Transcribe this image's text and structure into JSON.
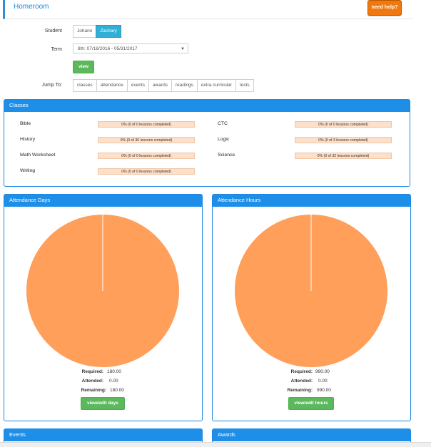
{
  "header": {
    "title": "Homeroom",
    "help_label": "need help?"
  },
  "form": {
    "student_label": "Student",
    "students": [
      "Johann",
      "Zachary"
    ],
    "selected_student": "Zachary",
    "term_label": "Term",
    "term_value": "8th: 07/18/2016 - 05/31/2017",
    "view_label": "view",
    "jump_label": "Jump To:",
    "jump_links": [
      "classes",
      "attendance",
      "events",
      "awards",
      "readings",
      "extra curricular",
      "tests"
    ]
  },
  "classes": {
    "title": "Classes",
    "left": [
      {
        "name": "Bible",
        "progress": "0% (0 of 0 lessons completed)"
      },
      {
        "name": "History",
        "progress": "0% (0 of 36 lessons completed)"
      },
      {
        "name": "Math Worksheet",
        "progress": "0% (0 of 0 lessons completed)"
      },
      {
        "name": "Writing",
        "progress": "0% (0 of 0 lessons completed)"
      }
    ],
    "right": [
      {
        "name": "CTC",
        "progress": "0% (0 of 0 lessons completed)"
      },
      {
        "name": "Logic",
        "progress": "0% (0 of 3 lessons completed)"
      },
      {
        "name": "Science",
        "progress": "0% (0 of 32 lessons completed)"
      }
    ]
  },
  "attendance_days": {
    "title": "Attendance Days",
    "required_label": "Required:",
    "required": "180.00",
    "attended_label": "Attended:",
    "attended": "0.00",
    "remaining_label": "Remaining:",
    "remaining": "180.00",
    "button": "view/edit days"
  },
  "attendance_hours": {
    "title": "Attendance Hours",
    "required_label": "Required:",
    "required": "990.00",
    "attended_label": "Attended:",
    "attended": "0.00",
    "remaining_label": "Remaining:",
    "remaining": "990.00",
    "button": "view/edit hours"
  },
  "events": {
    "title": "Events"
  },
  "awards": {
    "title": "Awards"
  },
  "colors": {
    "accent": "#1e8fe8",
    "pie": "#ff9f5a",
    "button_green": "#5cb85c",
    "help_orange": "#f0780e"
  }
}
